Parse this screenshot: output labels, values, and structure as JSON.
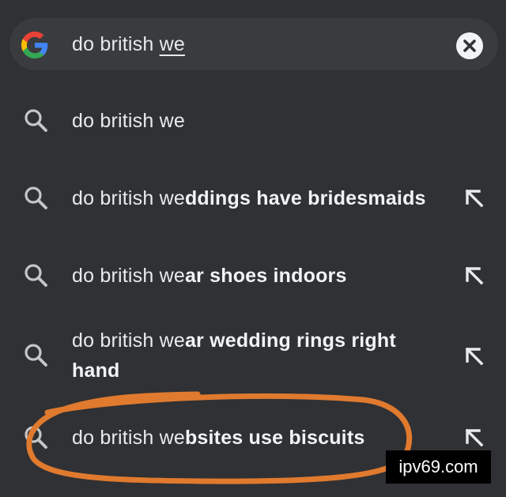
{
  "search": {
    "prefix": "do british ",
    "typed": "we"
  },
  "suggestions": [
    {
      "typed": "do british we",
      "completion": "",
      "line2": "",
      "has_arrow": false
    },
    {
      "typed": "do british we",
      "completion": "ddings have bridesmaids",
      "line2": "",
      "has_arrow": true
    },
    {
      "typed": "do british we",
      "completion": "ar shoes indoors",
      "line2": "",
      "has_arrow": true
    },
    {
      "typed": "do british we",
      "completion": "ar wedding rings right",
      "line2": "hand",
      "has_arrow": true
    },
    {
      "typed": "do british we",
      "completion": "bsites use biscuits",
      "line2": "",
      "has_arrow": true
    }
  ],
  "watermark": "ipv69.com",
  "colors": {
    "background": "#303134",
    "text": "#e8eaed",
    "annotation_circle": "#e07a2e"
  }
}
